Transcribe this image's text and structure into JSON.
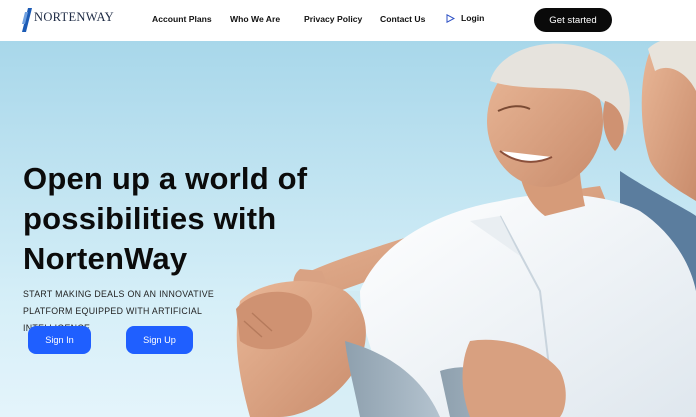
{
  "header": {
    "brand": "NORTENWAY",
    "nav": [
      {
        "label": "Account Plans"
      },
      {
        "label": "Who We Are"
      },
      {
        "label": "Privacy Policy"
      },
      {
        "label": "Contact Us"
      }
    ],
    "login_label": "Login",
    "login_icon": "play-triangle-icon",
    "cta_label": "Get started"
  },
  "hero": {
    "headline_lines": [
      "Open up a world of",
      "possibilities with",
      "NortenWay"
    ],
    "subtext_lines": [
      "START MAKING DEALS ON AN INNOVATIVE",
      "PLATFORM EQUIPPED WITH ARTIFICIAL",
      "INTELLIGENCE"
    ],
    "sign_in_label": "Sign In",
    "sign_up_label": "Sign Up"
  },
  "colors": {
    "primary_button": "#1f5fff",
    "cta_background": "#0a0a0a",
    "sky": "#bfe3f1",
    "brand_mark": "#1c5bb5"
  }
}
